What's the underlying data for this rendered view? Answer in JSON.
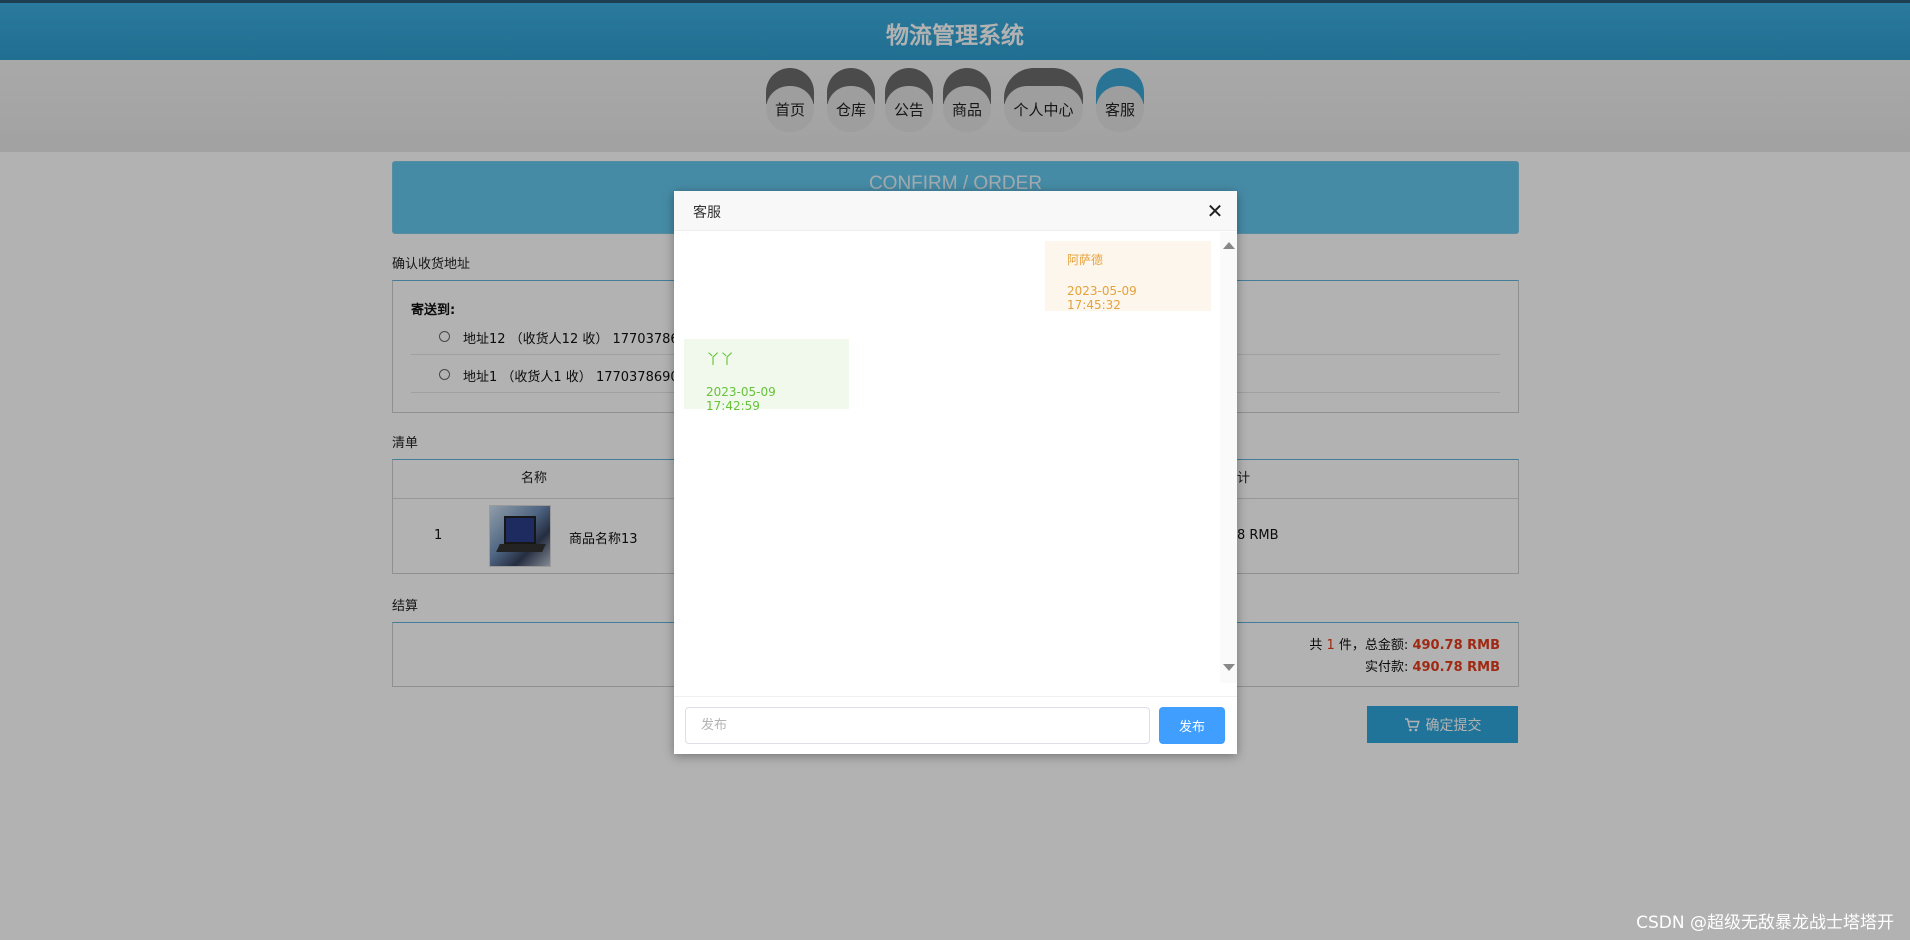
{
  "app": {
    "title": "物流管理系统"
  },
  "nav": {
    "items": [
      {
        "label": "首页"
      },
      {
        "label": "仓库"
      },
      {
        "label": "公告"
      },
      {
        "label": "商品"
      },
      {
        "label": "个人中心"
      },
      {
        "label": "客服",
        "active": true
      }
    ]
  },
  "order": {
    "banner": "CONFIRM / ORDER",
    "address_section": "确认收货地址",
    "ship_to_label": "寄送到:",
    "addresses": [
      {
        "text": "地址12 （收货人12 收） 17703786",
        "selected": false
      },
      {
        "text": "地址1 （收货人1 收） 1770378690",
        "selected": false
      }
    ],
    "list_section": "清单",
    "table_headers": {
      "name": "名称",
      "subtotal": "计"
    },
    "rows": [
      {
        "index": "1",
        "name": "商品名称13",
        "subtotal": "8 RMB"
      }
    ],
    "settle_section": "结算",
    "summary": {
      "count_prefix": "共 ",
      "count": "1",
      "count_suffix": " 件，总金额: ",
      "total": "490.78 RMB",
      "paid_label": "实付款: ",
      "paid": "490.78 RMB"
    },
    "submit_label": "确定提交"
  },
  "dialog": {
    "title": "客服",
    "messages": [
      {
        "side": "me",
        "name": "阿萨德",
        "time": "2023-05-09 17:45:32"
      },
      {
        "side": "other",
        "name": "丫丫",
        "time": "2023-05-09 17:42:59"
      }
    ],
    "input_placeholder": "发布",
    "input_value": "",
    "send_label": "发布"
  },
  "watermark": "CSDN @超级无敌暴龙战士塔塔开",
  "colors": {
    "header": "#2f9fd0",
    "nav_active": "#3ba6d5",
    "price_red": "#e43b1b",
    "send_button": "#409eff",
    "bubble_me_text": "#e6a23c",
    "bubble_other_text": "#67c23a"
  },
  "icons": {
    "close": "close-icon",
    "cart": "cart-icon"
  }
}
